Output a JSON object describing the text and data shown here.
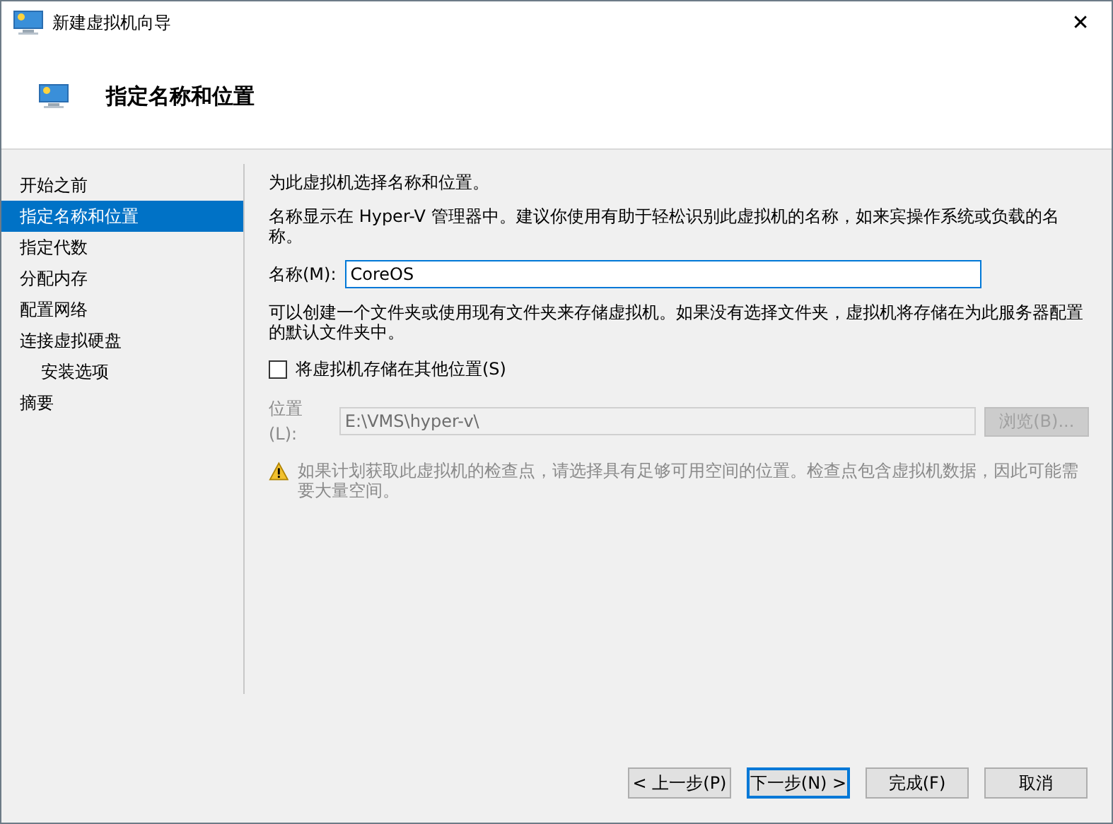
{
  "window": {
    "title": "新建虚拟机向导",
    "close": "✕"
  },
  "header": {
    "title": "指定名称和位置"
  },
  "sidebar": {
    "items": [
      {
        "label": "开始之前",
        "selected": false
      },
      {
        "label": "指定名称和位置",
        "selected": true
      },
      {
        "label": "指定代数",
        "selected": false
      },
      {
        "label": "分配内存",
        "selected": false
      },
      {
        "label": "配置网络",
        "selected": false
      },
      {
        "label": "连接虚拟硬盘",
        "selected": false,
        "children": [
          {
            "label": "安装选项",
            "selected": false
          }
        ]
      },
      {
        "label": "摘要",
        "selected": false
      }
    ]
  },
  "content": {
    "intro": "为此虚拟机选择名称和位置。",
    "name_hint": "名称显示在 Hyper-V 管理器中。建议你使用有助于轻松识别此虚拟机的名称，如来宾操作系统或负载的名称。",
    "name_field": {
      "label": "名称(M):",
      "value": "CoreOS"
    },
    "folder_hint": "可以创建一个文件夹或使用现有文件夹来存储虚拟机。如果没有选择文件夹，虚拟机将存储在为此服务器配置的默认文件夹中。",
    "store_elsewhere": {
      "label": "将虚拟机存储在其他位置(S)",
      "checked": false
    },
    "location_field": {
      "label": "位置(L):",
      "value": "E:\\VMS\\hyper-v\\",
      "disabled": true
    },
    "browse_button": {
      "label": "浏览(B)...",
      "disabled": true
    },
    "warning": "如果计划获取此虚拟机的检查点，请选择具有足够可用空间的位置。检查点包含虚拟机数据，因此可能需要大量空间。"
  },
  "buttons": [
    {
      "label": "< 上一步(P)",
      "default": false
    },
    {
      "label": "下一步(N) >",
      "default": true
    },
    {
      "label": "完成(F)",
      "default": false
    },
    {
      "label": "取消",
      "default": false
    }
  ]
}
